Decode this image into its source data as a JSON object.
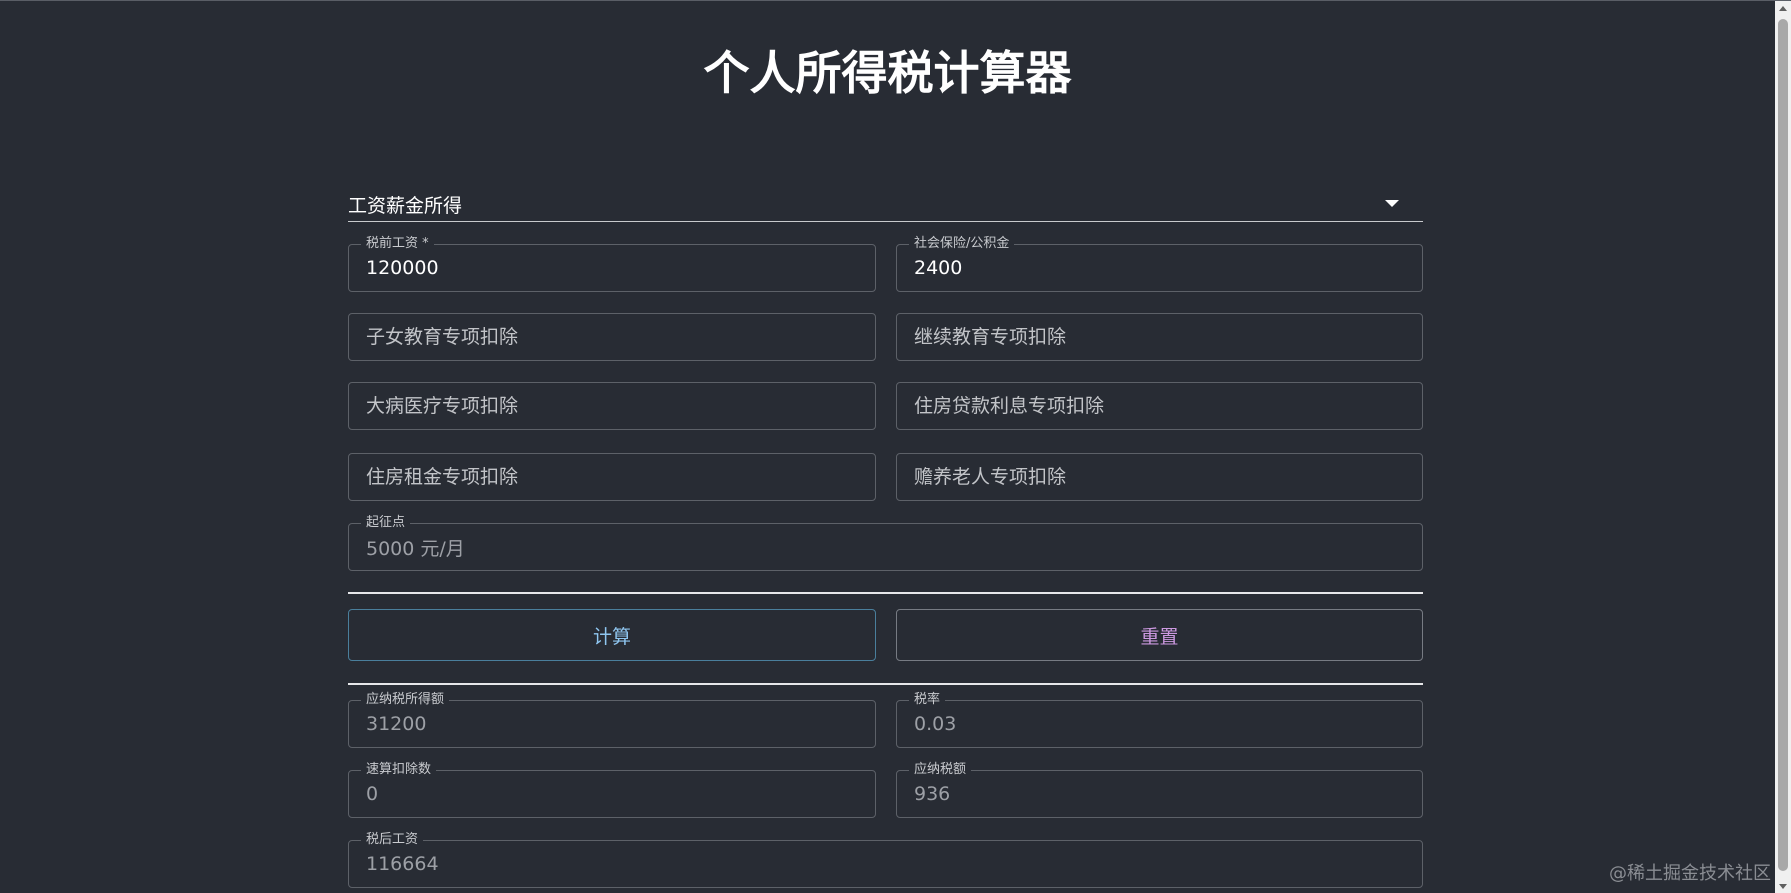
{
  "page": {
    "title": "个人所得税计算器"
  },
  "income_type": {
    "selected": "工资薪金所得"
  },
  "inputs": {
    "pre_tax_salary": {
      "label": "税前工资 *",
      "value": "120000"
    },
    "social_insurance": {
      "label": "社会保险/公积金",
      "value": "2400"
    },
    "child_education": {
      "placeholder": "子女教育专项扣除"
    },
    "continuing_education": {
      "placeholder": "继续教育专项扣除"
    },
    "serious_illness": {
      "placeholder": "大病医疗专项扣除"
    },
    "housing_loan_interest": {
      "placeholder": "住房贷款利息专项扣除"
    },
    "housing_rent": {
      "placeholder": "住房租金专项扣除"
    },
    "elderly_support": {
      "placeholder": "赡养老人专项扣除"
    },
    "threshold": {
      "label": "起征点",
      "value": "5000 元/月"
    }
  },
  "buttons": {
    "calculate": "计算",
    "reset": "重置"
  },
  "results": {
    "taxable_income": {
      "label": "应纳税所得额",
      "value": "31200"
    },
    "tax_rate": {
      "label": "税率",
      "value": "0.03"
    },
    "quick_deduction": {
      "label": "速算扣除数",
      "value": "0"
    },
    "tax_payable": {
      "label": "应纳税额",
      "value": "936"
    },
    "after_tax_salary": {
      "label": "税后工资",
      "value": "116664"
    }
  },
  "watermark": "@稀土掘金技术社区"
}
